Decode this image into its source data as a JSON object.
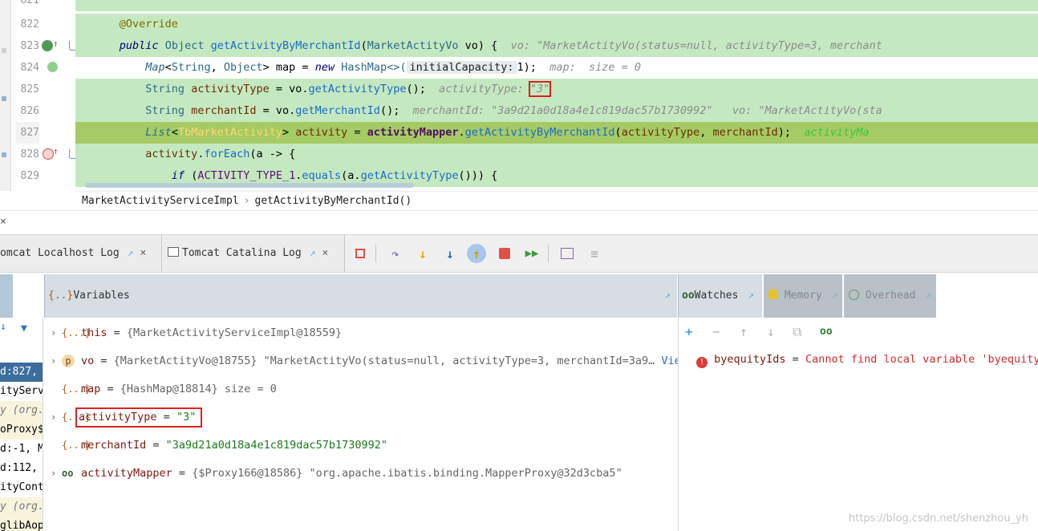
{
  "editor": {
    "lines": [
      {
        "num": "821"
      },
      {
        "num": "822",
        "annotation": "@Override"
      },
      {
        "num": "823",
        "public_kw": "public",
        "ret_type": "Object",
        "method_name": "getActivityByMerchantId",
        "param_type": "MarketActityVo",
        "param_name": "vo",
        "brace": ") {",
        "hint": "vo: \"MarketActityVo(status=null, activityType=3, merchant"
      },
      {
        "num": "824",
        "map_type": "Map",
        "generic_a": "String",
        "generic_b": "Object",
        "var_map": "map",
        "new_kw": "new",
        "hashmap": "HashMap<>(",
        "param_hint": "initialCapacity:",
        "arg": "1);",
        "hint": "map:  size = 0"
      },
      {
        "num": "825",
        "type_string": "String",
        "var_name": "activityType",
        "assign": " = vo.",
        "getter": "getActivityType",
        "call": "();",
        "hint_label": "activityType:",
        "hint_value": "\"3\""
      },
      {
        "num": "826",
        "type_string": "String",
        "var_name": "merchantId",
        "assign": " = vo.",
        "getter": "getMerchantId",
        "call": "();",
        "hint": "merchantId: \"3a9d21a0d18a4e1c819dac57b1730992\"   vo: \"MarketActityVo(sta"
      },
      {
        "num": "827",
        "list_type": "List",
        "tb_type": "TbMarketActivity",
        "var_name": "activity",
        "eq": " = ",
        "mapper": "activityMapper",
        "dot": ".",
        "method": "getActivityByMerchantId",
        "args_open": "(",
        "arg1": "activityType",
        "comma": ", ",
        "arg2": "merchantId",
        "args_close": ");",
        "hint": "activityMa"
      },
      {
        "num": "828",
        "var_name": "activity",
        "dot": ".",
        "method": "forEach",
        "rest": "(a -> {"
      },
      {
        "num": "829",
        "if_kw": "if",
        "open": " (",
        "const": "ACTIVITY_TYPE_1",
        "dot": ".",
        "method": "equals",
        "mid": "(a.",
        "getter": "getActivityType",
        "end": "())) {"
      }
    ]
  },
  "breadcrumb": {
    "class_name": "MarketActivityServiceImpl",
    "method_name": "getActivityByMerchantId()"
  },
  "debugger": {
    "close_label": "×",
    "tabs": [
      {
        "label": "omcat Localhost Log",
        "pin": "↗",
        "close": "×"
      },
      {
        "label": "Tomcat Catalina Log",
        "pin": "↗",
        "close": "×"
      }
    ],
    "panels": {
      "variables_title": "Variables",
      "watches_title": "Watches",
      "memory_title": "Memory",
      "overhead_title": "Overhead",
      "pin": "↗"
    },
    "frames": [
      {
        "text": "d:827, ",
        "selected": true
      },
      {
        "text": "ityServ"
      },
      {
        "text": "y (org.",
        "italic": true
      },
      {
        "text": "oProxy$"
      },
      {
        "text": "d:-1, M"
      },
      {
        "text": "d:112, "
      },
      {
        "text": "ityCont"
      },
      {
        "text": "y (org.",
        "italic": true
      },
      {
        "text": "glibAop"
      }
    ],
    "variables": [
      {
        "icon": "{...}",
        "name": "this",
        "eq": " = ",
        "value": "{MarketActivityServiceImpl@18559}",
        "expandable": true
      },
      {
        "icon": "p",
        "name": "vo",
        "eq": " = ",
        "value": "{MarketActityVo@18755} ",
        "str": "\"MarketActityVo(status=null, activityType=3, merchantId=3a9…",
        "link": "View",
        "expandable": true
      },
      {
        "icon": "{...}",
        "name": "map",
        "eq": " = ",
        "value": "{HashMap@18814}  size = 0",
        "expandable": false
      },
      {
        "icon": "{...}",
        "name": "activityType",
        "eq": " = ",
        "str": "\"3\"",
        "expandable": true,
        "highlight": true
      },
      {
        "icon": "{...}",
        "name": "merchantId",
        "eq": " = ",
        "str": "\"3a9d21a0d18a4e1c819dac57b1730992\"",
        "expandable": false
      },
      {
        "icon": "oo",
        "name": "activityMapper",
        "eq": " = ",
        "value": "{$Proxy166@18586} ",
        "str": "\"org.apache.ibatis.binding.MapperProxy@32d3cba5\"",
        "expandable": true
      }
    ],
    "watches": {
      "add": "+",
      "remove": "−",
      "up": "↑",
      "down": "↓",
      "copy": "⧉",
      "glasses": "oo",
      "item_name": "byequityIds",
      "item_eq": " = ",
      "item_error": "Cannot find local variable 'byequityI"
    }
  },
  "watermark": "https://blog.csdn.net/shenzhou_yh",
  "colors": {
    "exec_line": "#a5cb66",
    "highlight_line": "#c4e9c0",
    "error": "#e02020",
    "accent": "#2f6fb7"
  }
}
